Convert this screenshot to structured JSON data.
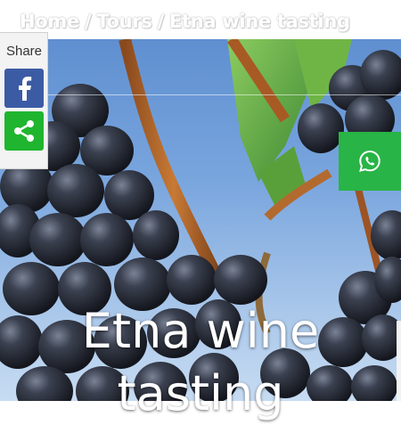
{
  "breadcrumb": {
    "home": "Home",
    "separator": "/",
    "tours": "Tours",
    "current": "Etna wine tasting"
  },
  "hero": {
    "title_line1": "Etna wine",
    "title_line2": "tasting"
  },
  "share": {
    "label": "Share",
    "facebook_icon": "facebook-icon",
    "share_icon": "share-icon",
    "colors": {
      "facebook": "#3b5ba5",
      "share": "#1fb52f"
    }
  },
  "whatsapp": {
    "icon": "whatsapp-icon",
    "color": "#28b446"
  }
}
